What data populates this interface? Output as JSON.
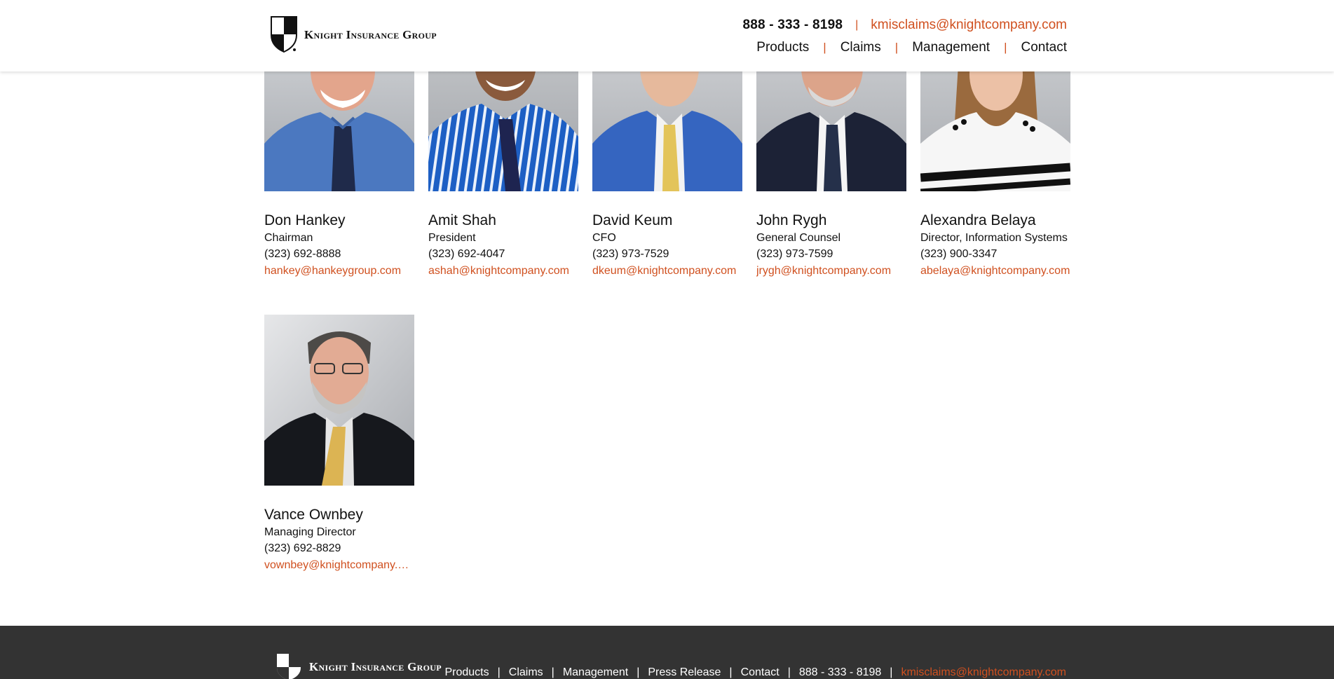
{
  "header": {
    "logo_text": "Knight Insurance Group",
    "phone": "888 - 333 - 8198",
    "separator": "|",
    "email": "kmisclaims@knightcompany.com",
    "nav": [
      "Products",
      "Claims",
      "Management",
      "Contact"
    ]
  },
  "team": [
    {
      "name": "Don Hankey",
      "title": "Chairman",
      "phone": "(323) 692-8888",
      "email": "hankey@hankeygroup.com"
    },
    {
      "name": "Amit Shah",
      "title": "President",
      "phone": "(323) 692-4047",
      "email": "ashah@knightcompany.com"
    },
    {
      "name": "David Keum",
      "title": "CFO",
      "phone": "(323) 973-7529",
      "email": "dkeum@knightcompany.com"
    },
    {
      "name": "John Rygh",
      "title": "General Counsel",
      "phone": "(323) 973-7599",
      "email": "jrygh@knightcompany.com"
    },
    {
      "name": "Alexandra Belaya",
      "title": "Director, Information Systems",
      "phone": "(323) 900-3347",
      "email": "abelaya@knightcompany.com"
    },
    {
      "name": "Vance Ownbey",
      "title": "Managing Director",
      "phone": "(323) 692-8829",
      "email": "vownbey@knightcompany.com"
    }
  ],
  "footer": {
    "logo_text": "Knight Insurance Group",
    "nav": [
      "Products",
      "Claims",
      "Management",
      "Press Release",
      "Contact"
    ],
    "phone": "888 - 333 - 8198",
    "email": "kmisclaims@knightcompany.com",
    "separator": "|"
  },
  "colors": {
    "accent": "#d0501f",
    "footer_bg": "#333333",
    "text": "#111111"
  },
  "icons": {
    "logo": "shield-checkered-icon"
  }
}
